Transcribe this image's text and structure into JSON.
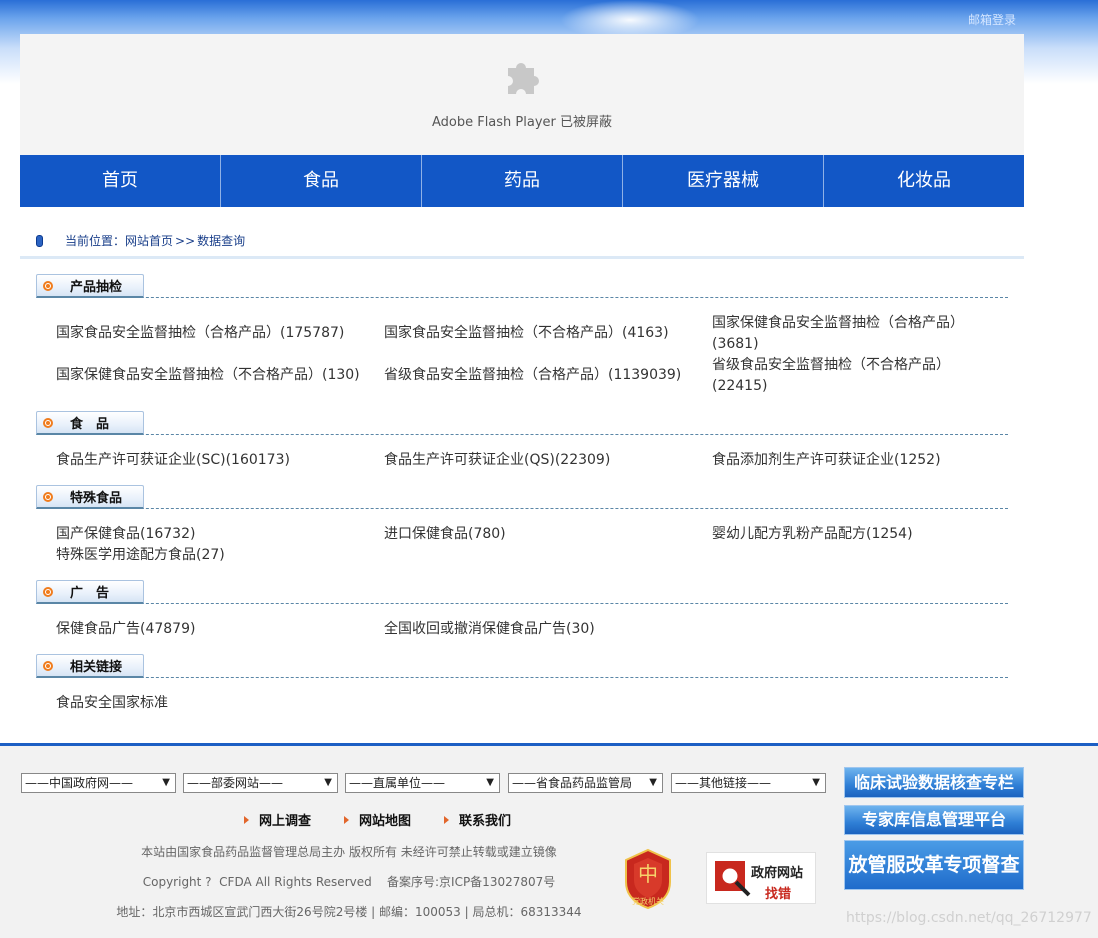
{
  "header": {
    "mail_login": "邮箱登录",
    "flash_notice": "Adobe Flash Player 已被屏蔽"
  },
  "nav": {
    "items": [
      "首页",
      "食品",
      "药品",
      "医疗器械",
      "化妆品"
    ]
  },
  "breadcrumb": {
    "prefix": "当前位置：",
    "home": "网站首页",
    "separator": ">>",
    "current": "数据查询"
  },
  "sections": {
    "sampling": {
      "title": "产品抽检",
      "items": [
        "国家食品安全监督抽检（合格产品）(175787)",
        "国家食品安全监督抽检（不合格产品）(4163)",
        "国家保健食品安全监督抽检（合格产品）",
        "(3681)",
        "国家保健食品安全监督抽检（不合格产品）(130)",
        "省级食品安全监督抽检（合格产品）(1139039)",
        "省级食品安全监督抽检（不合格产品）",
        "(22415)"
      ]
    },
    "food": {
      "title": "食　品",
      "items": [
        "食品生产许可获证企业(SC)(160173)",
        "食品生产许可获证企业(QS)(22309)",
        "食品添加剂生产许可获证企业(1252)"
      ]
    },
    "special": {
      "title": "特殊食品",
      "items": [
        "国产保健食品(16732)",
        "进口保健食品(780)",
        "婴幼儿配方乳粉产品配方(1254)",
        "特殊医学用途配方食品(27)"
      ]
    },
    "ads": {
      "title": "广　告",
      "items": [
        "保健食品广告(47879)",
        "全国收回或撤消保健食品广告(30)"
      ]
    },
    "links": {
      "title": "相关链接",
      "items": [
        "食品安全国家标准"
      ]
    }
  },
  "footer": {
    "selects": [
      "——中国政府网——",
      "——部委网站——",
      "——直属单位——",
      "——省食品药品监管局",
      "——其他链接——"
    ],
    "links": [
      "网上调查",
      "网站地图",
      "联系我们"
    ],
    "line1": "本站由国家食品药品监督管理总局主办 版权所有 未经许可禁止转载或建立镜像",
    "line2": "Copyright ?  CFDA All Rights Reserved    备案序号:京ICP备13027807号",
    "line3": "地址：北京市西城区宣武门西大街26号院2号楼 | 邮编：100053 | 局总机：68313344",
    "badge_text": "党政机关",
    "gov_line1": "政府网站",
    "gov_line2": "找错",
    "banners": [
      "临床试验数据核查专栏",
      "专家库信息管理平台",
      "放管服改革专项督查"
    ],
    "watermark": "https://blog.csdn.net/qq_26712977"
  }
}
